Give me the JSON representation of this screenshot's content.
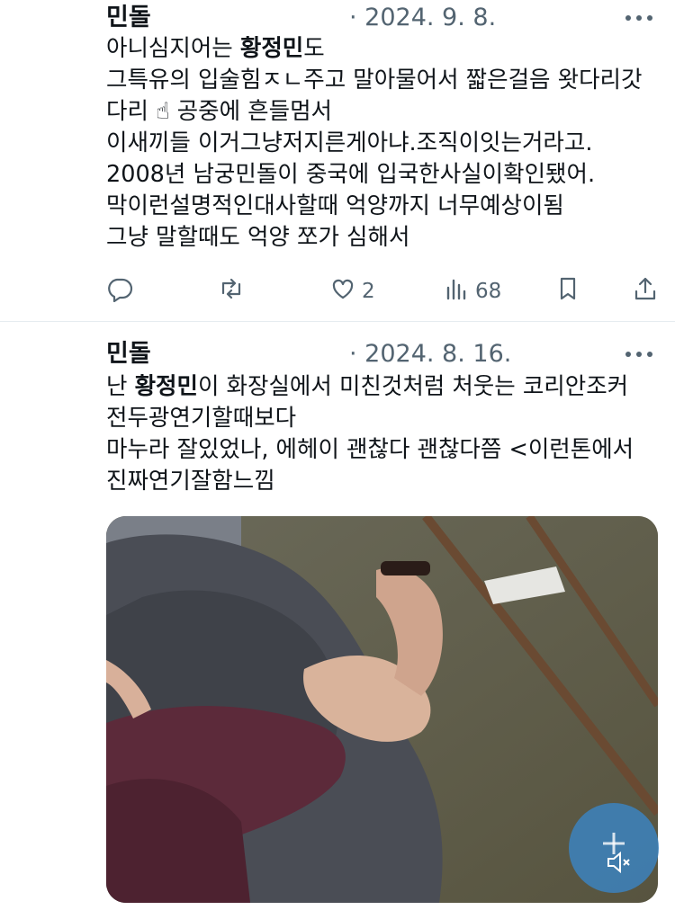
{
  "tweets": [
    {
      "author": "민돌",
      "date": "· 2024. 9. 8.",
      "lines": [
        {
          "pre": "아니심지어는 ",
          "bold": "황정민",
          "post": "도"
        },
        {
          "pre": "그특유의 입술힘ㅈㄴ주고 말아물어서 짧은걸음 왓다리갓",
          "bold": "",
          "post": ""
        },
        {
          "pre": "다리 ☝ 공중에 흔들멈서",
          "bold": "",
          "post": ""
        },
        {
          "pre": "이새끼들 이거그냥저지른게아냐.조직이잇는거라고.",
          "bold": "",
          "post": ""
        },
        {
          "pre": "2008년 남궁민돌이 중국에 입국한사실이확인됐어.",
          "bold": "",
          "post": ""
        },
        {
          "pre": "막이런설명적인대사할때 억양까지 너무예상이됨",
          "bold": "",
          "post": ""
        },
        {
          "pre": "그냥 말할때도 억양 쪼가 심해서",
          "bold": "",
          "post": ""
        }
      ],
      "actions": {
        "reply": "",
        "retweet": "",
        "like": "2",
        "views": "68"
      }
    },
    {
      "author": "민돌",
      "date": "· 2024. 8. 16.",
      "lines": [
        {
          "pre": "난 ",
          "bold": "황정민",
          "post": "이 화장실에서 미친것처럼 처웃는 코리안조커"
        },
        {
          "pre": "전두광연기할때보다",
          "bold": "",
          "post": ""
        },
        {
          "pre": "마누라 잘있었나, 에헤이 괜찮다 괜찮다쯤 <이런톤에서",
          "bold": "",
          "post": ""
        },
        {
          "pre": "진짜연기잘함느낌",
          "bold": "",
          "post": ""
        }
      ]
    }
  ],
  "icons": {
    "more": "more-dots-icon",
    "reply": "reply-icon",
    "retweet": "retweet-icon",
    "like": "heart-icon",
    "views": "bar-chart-icon",
    "bookmark": "bookmark-icon",
    "share": "share-icon",
    "mute": "speaker-muted-icon"
  },
  "colors": {
    "text": "#0f1419",
    "muted": "#536471",
    "divider": "#e6ecf0",
    "mute_button": "#3c82be"
  }
}
